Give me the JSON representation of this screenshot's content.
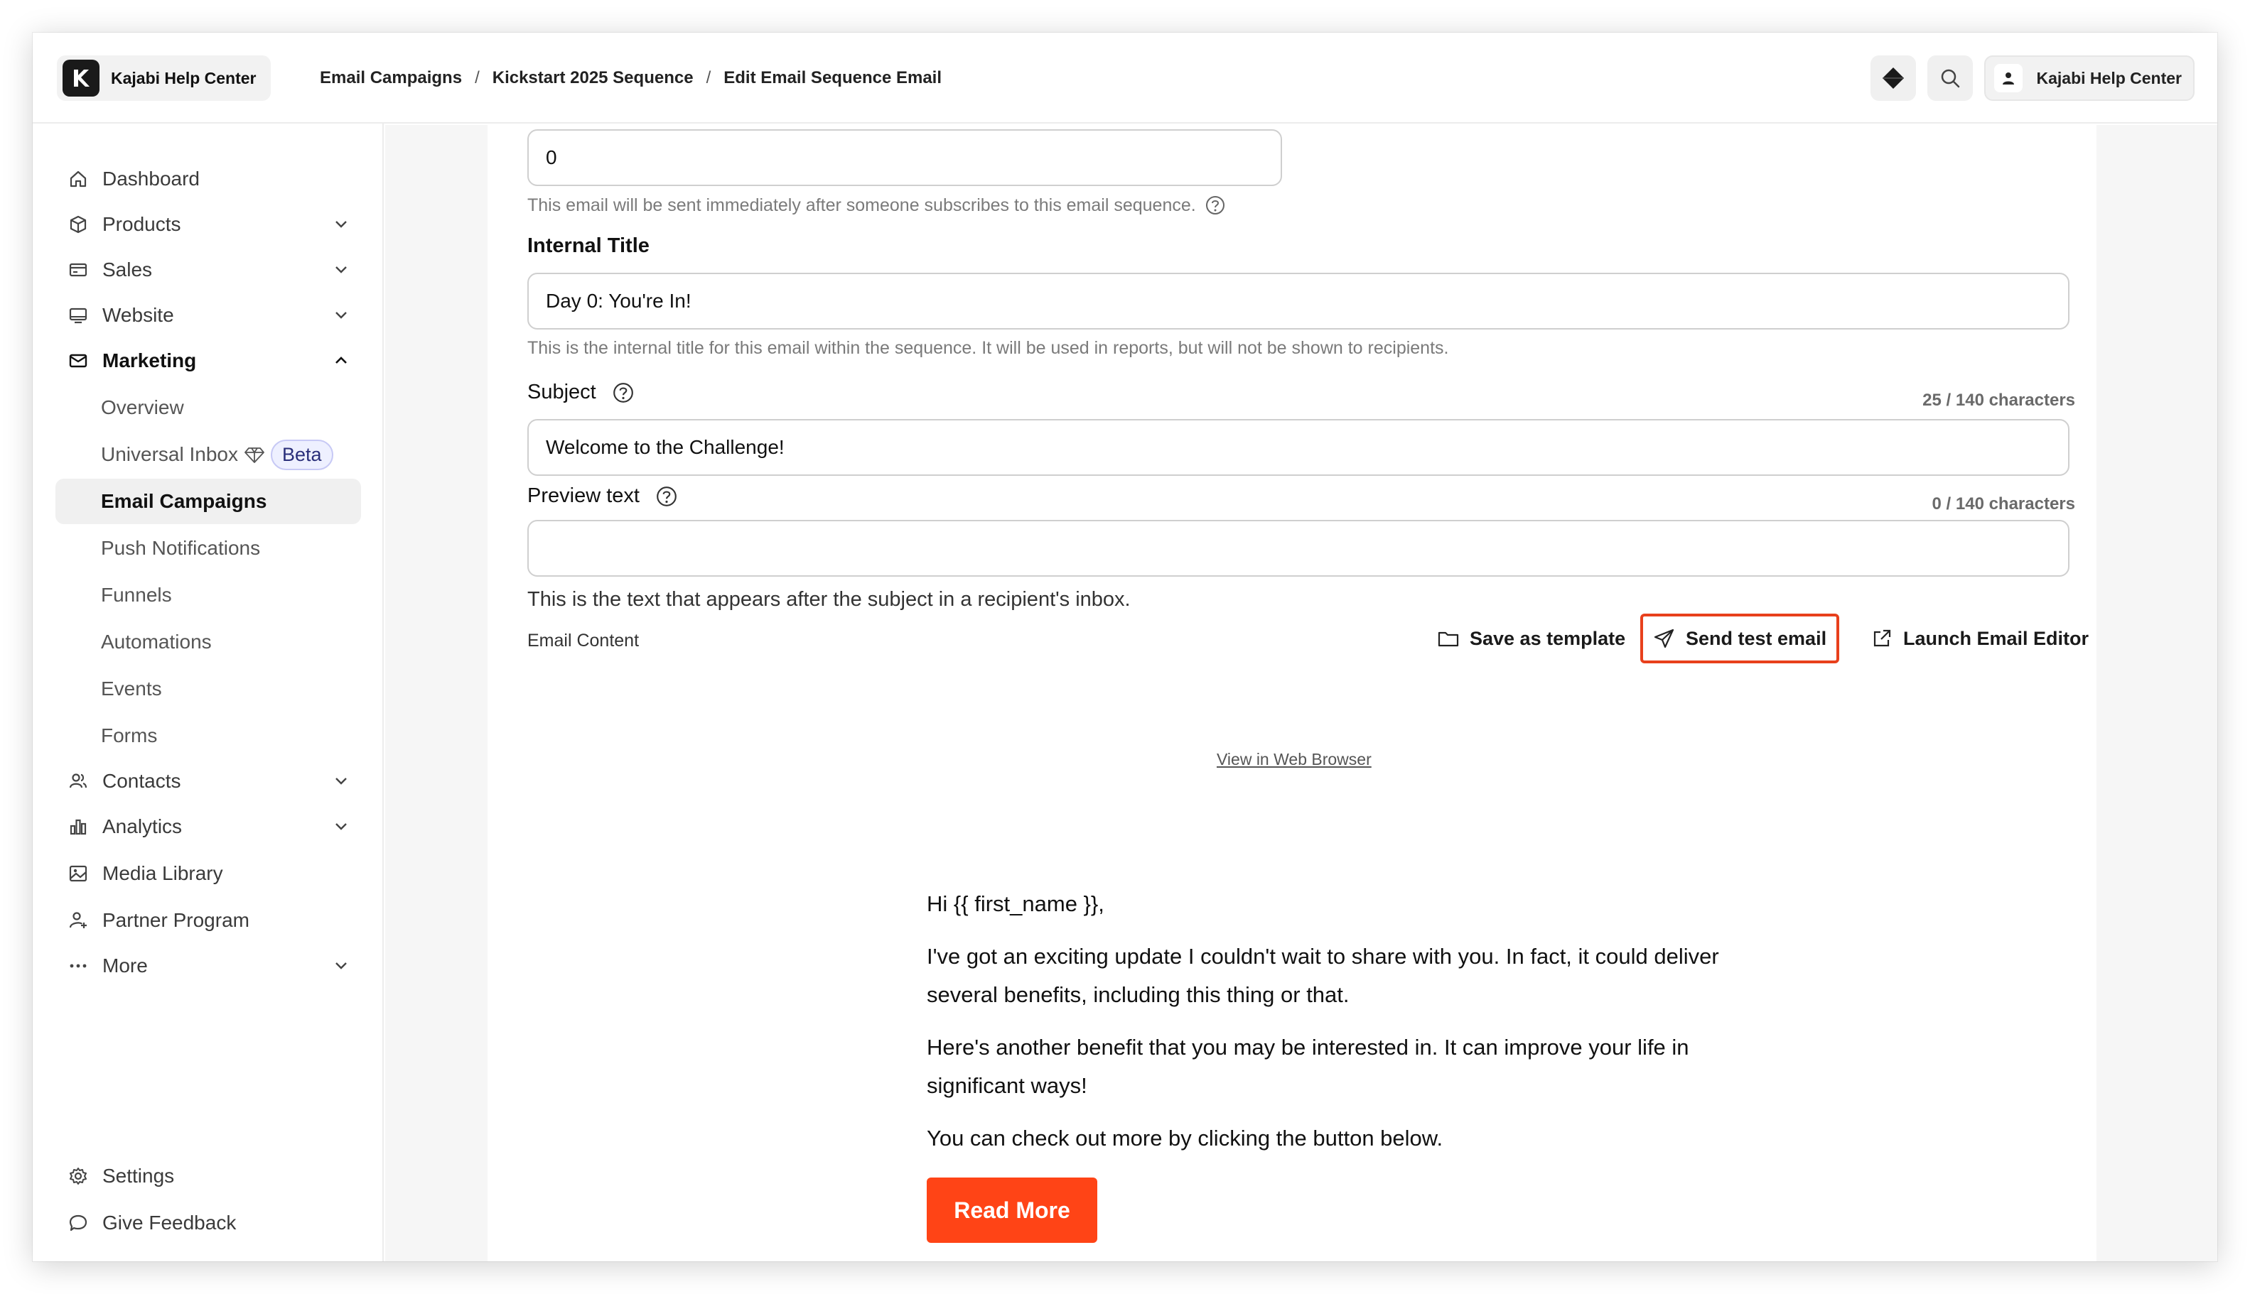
{
  "header": {
    "brand": "Kajabi Help Center",
    "breadcrumb": [
      "Email Campaigns",
      "Kickstart 2025 Sequence",
      "Edit Email Sequence Email"
    ],
    "user_name": "Kajabi Help Center"
  },
  "sidebar": {
    "items": [
      {
        "label": "Dashboard",
        "icon": "home-icon"
      },
      {
        "label": "Products",
        "icon": "cube-icon"
      },
      {
        "label": "Sales",
        "icon": "card-icon"
      },
      {
        "label": "Website",
        "icon": "monitor-icon"
      },
      {
        "label": "Marketing",
        "icon": "mail-icon"
      },
      {
        "label": "Contacts",
        "icon": "users-icon"
      },
      {
        "label": "Analytics",
        "icon": "chart-icon"
      },
      {
        "label": "Media Library",
        "icon": "image-icon"
      },
      {
        "label": "Partner Program",
        "icon": "partner-icon"
      },
      {
        "label": "More",
        "icon": "dots-icon"
      }
    ],
    "marketing_sub": [
      "Overview",
      "Universal Inbox",
      "Email Campaigns",
      "Push Notifications",
      "Funnels",
      "Automations",
      "Events",
      "Forms"
    ],
    "beta_badge": "Beta",
    "bottom": [
      {
        "label": "Settings",
        "icon": "gear-icon"
      },
      {
        "label": "Give Feedback",
        "icon": "chat-icon"
      }
    ]
  },
  "form": {
    "delay_value": "0",
    "delay_hint": "This email will be sent immediately after someone subscribes to this email sequence.",
    "internal_title_label": "Internal Title",
    "internal_title_value": "Day 0: You're In!",
    "internal_title_hint": "This is the internal title for this email within the sequence. It will be used in reports, but will not be shown to recipients.",
    "subject_label": "Subject",
    "subject_counter": "25 / 140 characters",
    "subject_value": "Welcome to the Challenge!",
    "preview_label": "Preview text",
    "preview_counter": "0 / 140 characters",
    "preview_value": "",
    "preview_hint": "This is the text that appears after the subject in a recipient's inbox.",
    "email_content_label": "Email Content"
  },
  "actions": {
    "save_template": "Save as template",
    "send_test": "Send test email",
    "launch_editor": "Launch Email Editor"
  },
  "email": {
    "web_link": "View in Web Browser",
    "greeting": "Hi {{ first_name }},",
    "para1": "I've got an exciting update I couldn't wait to share with you. In fact, it could deliver several benefits, including this thing or that.",
    "para2": "Here's another benefit that you may be interested in. It can improve your life in significant ways!",
    "para3": "You can check out more by clicking the button below.",
    "button": "Read More"
  },
  "colors": {
    "accent": "#FF4416",
    "highlight_border": "#E8401C",
    "beta_bg": "#EEF0FF"
  }
}
